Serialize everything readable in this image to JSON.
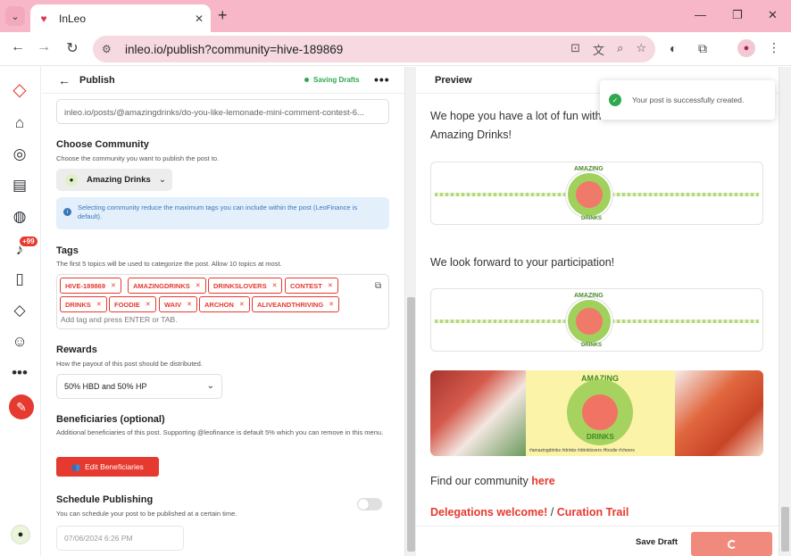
{
  "browser": {
    "tab_title": "InLeo",
    "url": "inleo.io/publish?community=hive-189869"
  },
  "editor": {
    "header_title": "Publish",
    "saving_status": "Saving Drafts",
    "permlink": "inleo.io/posts/@amazingdrinks/do-you-like-lemonade-mini-comment-contest-6...",
    "community": {
      "title": "Choose Community",
      "subtitle": "Choose the community you want to publish the post to.",
      "selected": "Amazing Drinks",
      "info": "Selecting community reduce the maximum tags you can include within the post (LeoFinance is default)."
    },
    "tags": {
      "title": "Tags",
      "subtitle": "The first 5 topics will be used to categorize the post. Allow 10 topics at most.",
      "items": [
        "HIVE-189869",
        "AMAZINGDRINKS",
        "DRINKSLOVERS",
        "CONTEST",
        "DRINKS",
        "FOODIE",
        "WAIV",
        "ARCHON",
        "ALIVEANDTHRIVING"
      ],
      "input_placeholder": "Add tag and press ENTER or TAB."
    },
    "rewards": {
      "title": "Rewards",
      "subtitle": "How the payout of this post should be distributed.",
      "selected": "50% HBD and 50% HP"
    },
    "beneficiaries": {
      "title": "Beneficiaries (optional)",
      "subtitle": "Additional beneficiaries of this post. Supporting @leofinance is default 5% which you can remove in this menu.",
      "button": "Edit Beneficiaries"
    },
    "schedule": {
      "title": "Schedule Publishing",
      "subtitle": "You can schedule your post to be published at a certain time.",
      "date_value": "07/06/2024 6:26 PM"
    }
  },
  "sidebar": {
    "notification_badge": "+99"
  },
  "preview": {
    "title": "Preview",
    "p1": "We hope you have a lot of fun with this themed contest",
    "p1b": "Amazing Drinks!",
    "p2": "We look forward to your participation!",
    "banner_top": "AMAZING",
    "banner_bottom": "DRINKS",
    "photo_tags": "#amazingdrinks  #drinks  #drinklovers  #foodie  #cheers",
    "p3_prefix": "Find our community",
    "p3_link": "here",
    "p4_link1": "Delegations welcome!",
    "p4_sep": "/",
    "p4_link2": "Curation Trail",
    "save_draft": "Save Draft"
  },
  "toast": {
    "message": "Your post is successfully created."
  },
  "colors": {
    "accent": "#e6392f",
    "success": "#2fa84f"
  }
}
